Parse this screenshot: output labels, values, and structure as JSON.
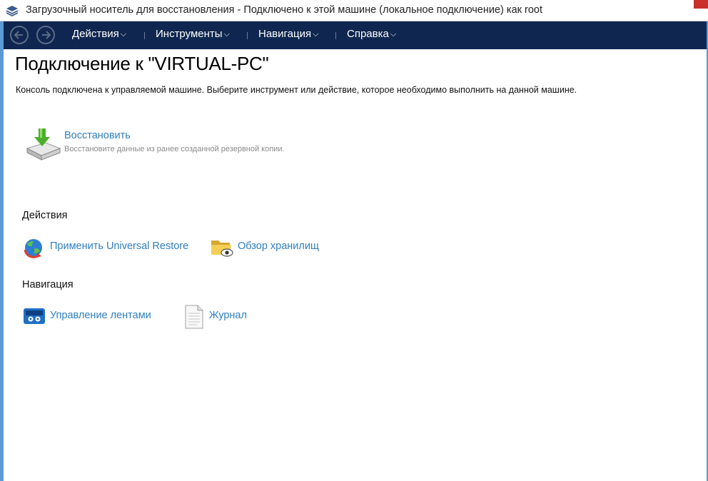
{
  "window": {
    "title": "Загрузочный носитель для восстановления - Подключено к этой машине (локальное подключение) как root"
  },
  "menubar": {
    "items": [
      {
        "label": "Действия"
      },
      {
        "label": "Инструменты"
      },
      {
        "label": "Навигация"
      },
      {
        "label": "Справка"
      }
    ]
  },
  "main": {
    "title": "Подключение к \"VIRTUAL-PC\"",
    "description": "Консоль подключена к управляемой машине. Выберите инструмент или действие, которое необходимо выполнить на данной машине.",
    "primary": {
      "label": "Восстановить",
      "description": "Восстановите данные из ранее созданной резервной копии."
    },
    "sections": {
      "actions": {
        "heading": "Действия",
        "items": [
          {
            "label": "Применить Universal Restore",
            "icon": "universal-restore-icon"
          },
          {
            "label": "Обзор хранилищ",
            "icon": "folder-eye-icon"
          }
        ]
      },
      "navigation": {
        "heading": "Навигация",
        "items": [
          {
            "label": "Управление лентами",
            "icon": "tape-icon"
          },
          {
            "label": "Журнал",
            "icon": "document-icon"
          }
        ]
      }
    }
  },
  "colors": {
    "menubar": "#0f2750",
    "link": "#2f7fc0",
    "frame": "#5b9bd5"
  }
}
